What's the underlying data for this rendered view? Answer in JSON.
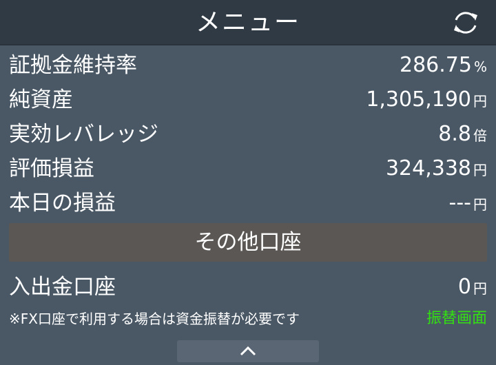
{
  "header": {
    "title": "メニュー",
    "refresh_icon": "refresh-icon"
  },
  "account": {
    "margin_ratio": {
      "label": "証拠金維持率",
      "value": "286.75",
      "unit": "%"
    },
    "net_assets": {
      "label": "純資産",
      "value": "1,305,190",
      "unit": "円"
    },
    "effective_leverage": {
      "label": "実効レバレッジ",
      "value": "8.8",
      "unit": "倍"
    },
    "unrealized_pl": {
      "label": "評価損益",
      "value": "324,338",
      "unit": "円"
    },
    "today_pl": {
      "label": "本日の損益",
      "value": "---",
      "unit": "円"
    }
  },
  "other_accounts": {
    "label": "その他口座"
  },
  "deposit": {
    "label": "入出金口座",
    "value": "0",
    "unit": "円"
  },
  "note": {
    "text": "※FX口座で利用する場合は資金振替が必要です",
    "link_label": "振替画面",
    "link_color": "#33e011"
  },
  "collapse": {
    "icon": "chevron-up-icon"
  }
}
